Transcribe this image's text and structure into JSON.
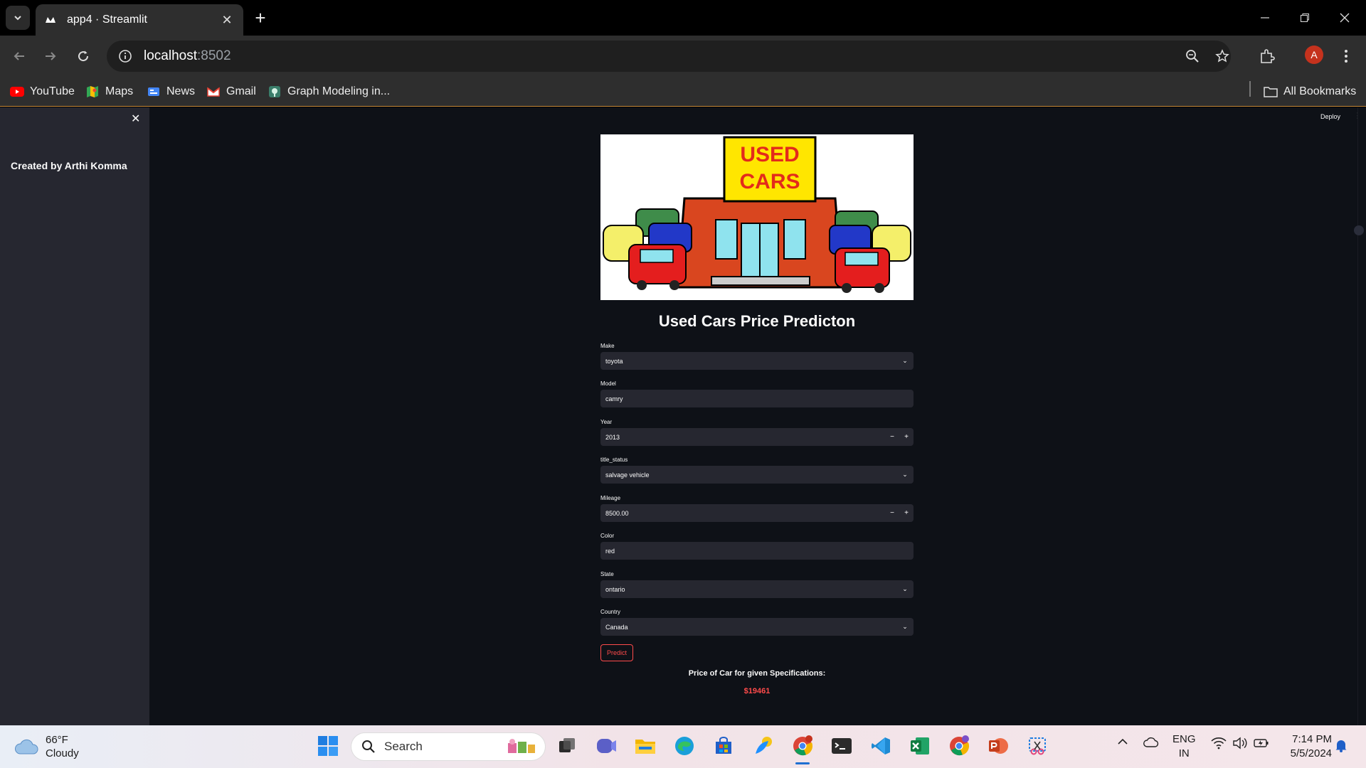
{
  "browser": {
    "tab_title": "app4 · Streamlit",
    "url_host": "localhost",
    "url_port": ":8502",
    "profile_initial": "A",
    "bookmarks": [
      {
        "label": "YouTube",
        "icon": "youtube-icon"
      },
      {
        "label": "Maps",
        "icon": "maps-icon"
      },
      {
        "label": "News",
        "icon": "news-icon"
      },
      {
        "label": "Gmail",
        "icon": "gmail-icon"
      },
      {
        "label": "Graph Modeling in...",
        "icon": "graph-icon"
      }
    ],
    "all_bookmarks": "All Bookmarks"
  },
  "app": {
    "sidebar_text": "Created by Arthi Komma",
    "deploy_label": "Deploy",
    "hero_sign": "USED CARS",
    "title": "Used Cars Price Predicton",
    "fields": {
      "make": {
        "label": "Make",
        "value": "toyota"
      },
      "model": {
        "label": "Model",
        "value": "camry"
      },
      "year": {
        "label": "Year",
        "value": "2013"
      },
      "title_status": {
        "label": "title_status",
        "value": "salvage vehicle"
      },
      "mileage": {
        "label": "Mileage",
        "value": "8500.00"
      },
      "color": {
        "label": "Color",
        "value": "red"
      },
      "state": {
        "label": "State",
        "value": "ontario"
      },
      "country": {
        "label": "Country",
        "value": "Canada"
      }
    },
    "predict_label": "Predict",
    "result_title": "Price of Car for given Specifications:",
    "result_value": "$19461",
    "accent_color": "#ff4b4b"
  },
  "taskbar": {
    "weather_temp": "66°F",
    "weather_desc": "Cloudy",
    "search_label": "Search",
    "lang_top": "ENG",
    "lang_bottom": "IN",
    "time": "7:14 PM",
    "date": "5/5/2024"
  }
}
